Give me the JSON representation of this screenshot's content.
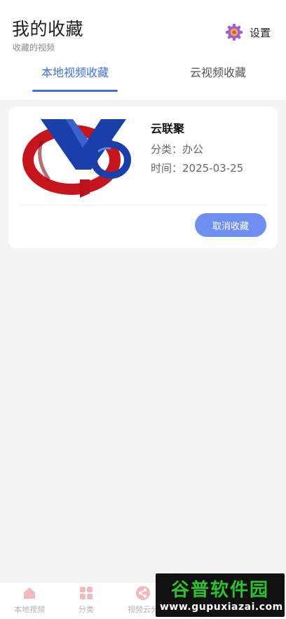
{
  "header": {
    "title": "我的收藏",
    "subtitle": "收藏的视频",
    "settings_label": "设置"
  },
  "tabs": [
    {
      "label": "本地视频收藏",
      "active": true
    },
    {
      "label": "云视频收藏",
      "active": false
    }
  ],
  "favorites": [
    {
      "name": "云联聚",
      "category": "分类：办公",
      "time": "时间：2025-03-25",
      "unfavorite_label": "取消收藏"
    }
  ],
  "bottom_nav": [
    {
      "label": "本地视频",
      "icon": "home-icon"
    },
    {
      "label": "分类",
      "icon": "grid-icon"
    },
    {
      "label": "视频云分",
      "icon": "share-icon"
    }
  ],
  "watermark": {
    "main": "谷普软件园",
    "sub": "www.gupuxiazai.com"
  },
  "colors": {
    "accent": "#3f71d6",
    "button": "#6d8ff0",
    "nav_icon": "#f4b9be"
  }
}
